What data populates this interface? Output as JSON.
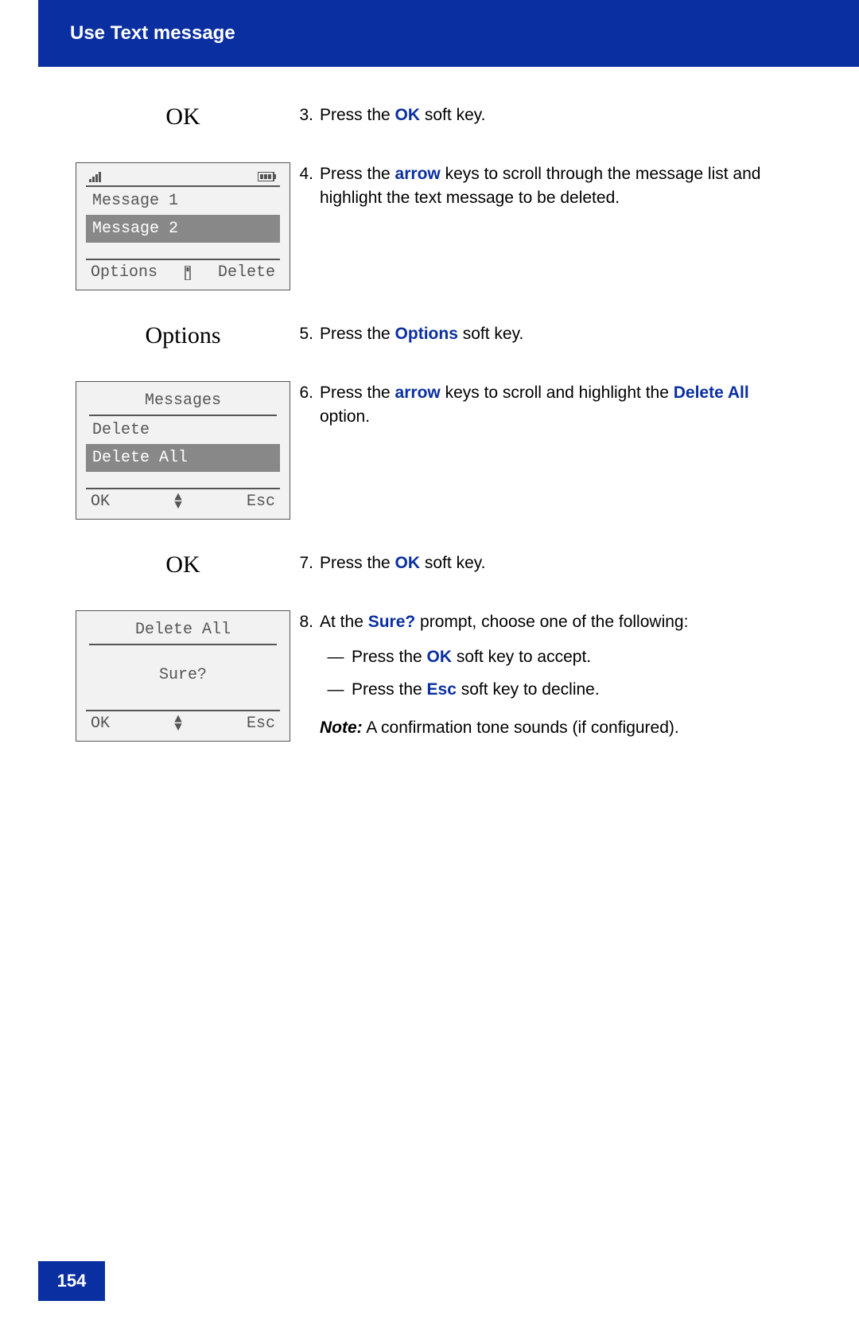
{
  "header": {
    "title": "Use Text message"
  },
  "page_number": "154",
  "labels": {
    "ok": "OK",
    "options_serif": "Options"
  },
  "steps": {
    "s3": {
      "num": "3.",
      "pre": "Press the ",
      "kw": "OK",
      "post": " soft key."
    },
    "s4": {
      "num": "4.",
      "pre": "Press the ",
      "kw": "arrow",
      "post": " keys to scroll through the message list and highlight the text message to be deleted."
    },
    "s5": {
      "num": "5.",
      "pre": "Press the ",
      "kw": "Options",
      "post": " soft key."
    },
    "s6": {
      "num": "6.",
      "pre": "Press the ",
      "kw": "arrow",
      "mid": " keys to scroll and highlight the ",
      "kw2": "Delete All",
      "post": " option."
    },
    "s7": {
      "num": "7.",
      "pre": "Press the ",
      "kw": "OK",
      "post": " soft key."
    },
    "s8": {
      "num": "8.",
      "pre": "At the ",
      "kw": "Sure?",
      "post": " prompt, choose one of the following:",
      "sub1_pre": "Press the ",
      "sub1_kw": "OK",
      "sub1_post": " soft key to accept.",
      "sub2_pre": "Press the ",
      "sub2_kw": "Esc",
      "sub2_post": " soft key to decline.",
      "note_label": "Note:",
      "note_text": " A confirmation tone sounds (if configured)."
    }
  },
  "screen1": {
    "msg1": "Message 1",
    "msg2": "Message 2",
    "sk_left": "Options",
    "sk_right": "Delete"
  },
  "screen2": {
    "title": "Messages",
    "item1": "Delete",
    "item2": "Delete All",
    "sk_left": "OK",
    "sk_right": "Esc"
  },
  "screen3": {
    "title": "Delete All",
    "body": "Sure?",
    "sk_left": "OK",
    "sk_right": "Esc"
  }
}
